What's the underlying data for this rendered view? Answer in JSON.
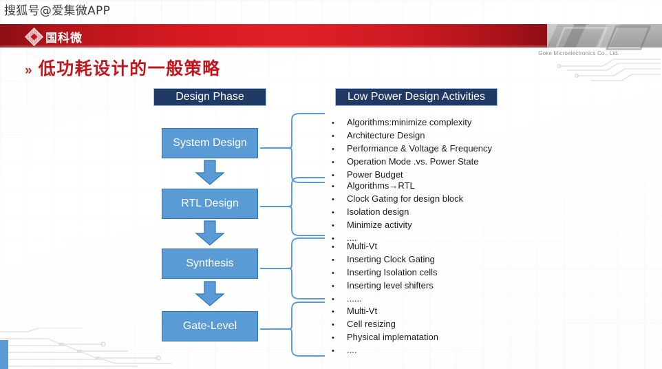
{
  "watermark": "搜狐号@爱集微APP",
  "brand": {
    "logo_cn": "国科微",
    "logo_icon": "diamond-logo-icon",
    "name_en": "Goke Microelectronics Co., Ltd.",
    "band_color": "#d41920"
  },
  "title": {
    "marker": "»",
    "text": "低功耗设计的一般策略",
    "color": "#c0161d"
  },
  "columns": {
    "phase_header": "Design Phase",
    "activities_header": "Low Power Design Activities",
    "header_bg": "#1f3864",
    "box_bg": "#5b9bd5"
  },
  "flow": [
    {
      "phase": "System Design",
      "activities": [
        "Algorithms:minimize complexity",
        "Architecture Design",
        "Performance & Voltage & Frequency",
        "Operation Mode .vs. Power State",
        "Power Budget"
      ]
    },
    {
      "phase": "RTL Design",
      "activities": [
        "Algorithms→RTL",
        "Clock Gating for design block",
        "Isolation design",
        "Minimize activity",
        "...."
      ]
    },
    {
      "phase": "Synthesis",
      "activities": [
        "Multi-Vt",
        "Inserting Clock Gating",
        "Inserting Isolation cells",
        "Inserting level shifters",
        "......"
      ]
    },
    {
      "phase": "Gate-Level",
      "activities": [
        "Multi-Vt",
        "Cell resizing",
        "Physical implematation",
        "...."
      ]
    }
  ],
  "bullet_glyph": "•"
}
